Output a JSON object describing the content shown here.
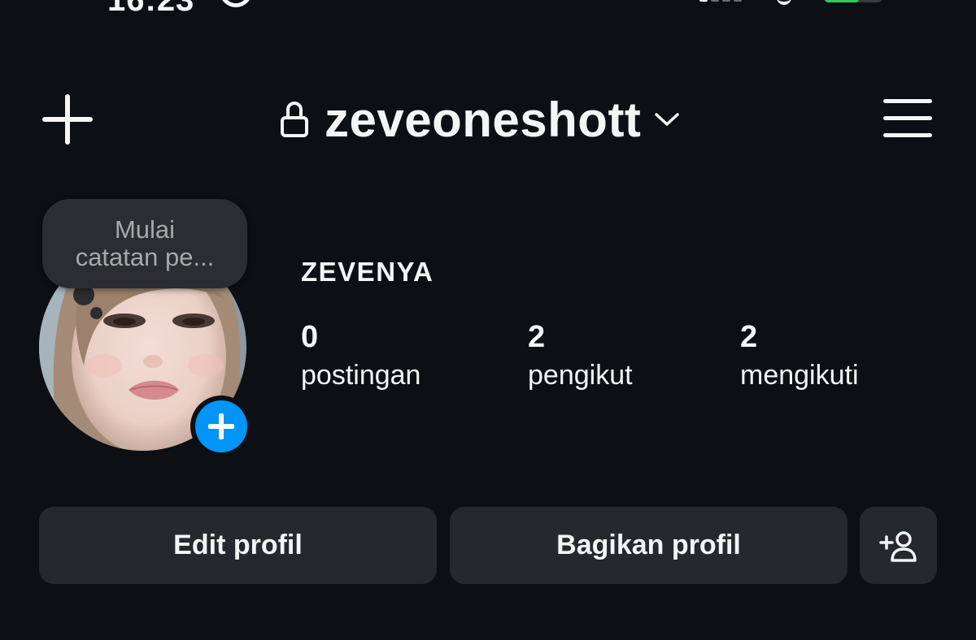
{
  "status_bar": {
    "battery_level": 0.6,
    "battery_color": "#34c759"
  },
  "header": {
    "username": "zeveoneshott",
    "icons": [
      "plus-icon",
      "lock-icon",
      "chevron-down-icon",
      "hamburger-menu-icon"
    ]
  },
  "note": {
    "text": "Mulai\ncatatan pe..."
  },
  "profile": {
    "display_name": "ZEVENYA",
    "stats": [
      {
        "value": "0",
        "label": "postingan"
      },
      {
        "value": "2",
        "label": "pengikut"
      },
      {
        "value": "2",
        "label": "mengikuti"
      }
    ]
  },
  "actions": {
    "edit_label": "Edit profil",
    "share_label": "Bagikan profil",
    "discover_icon": "add-person-icon"
  },
  "colors": {
    "background": "#0c1014",
    "button": "#25282d",
    "accent_blue": "#0095f6",
    "note_bg": "#2c2d31"
  }
}
